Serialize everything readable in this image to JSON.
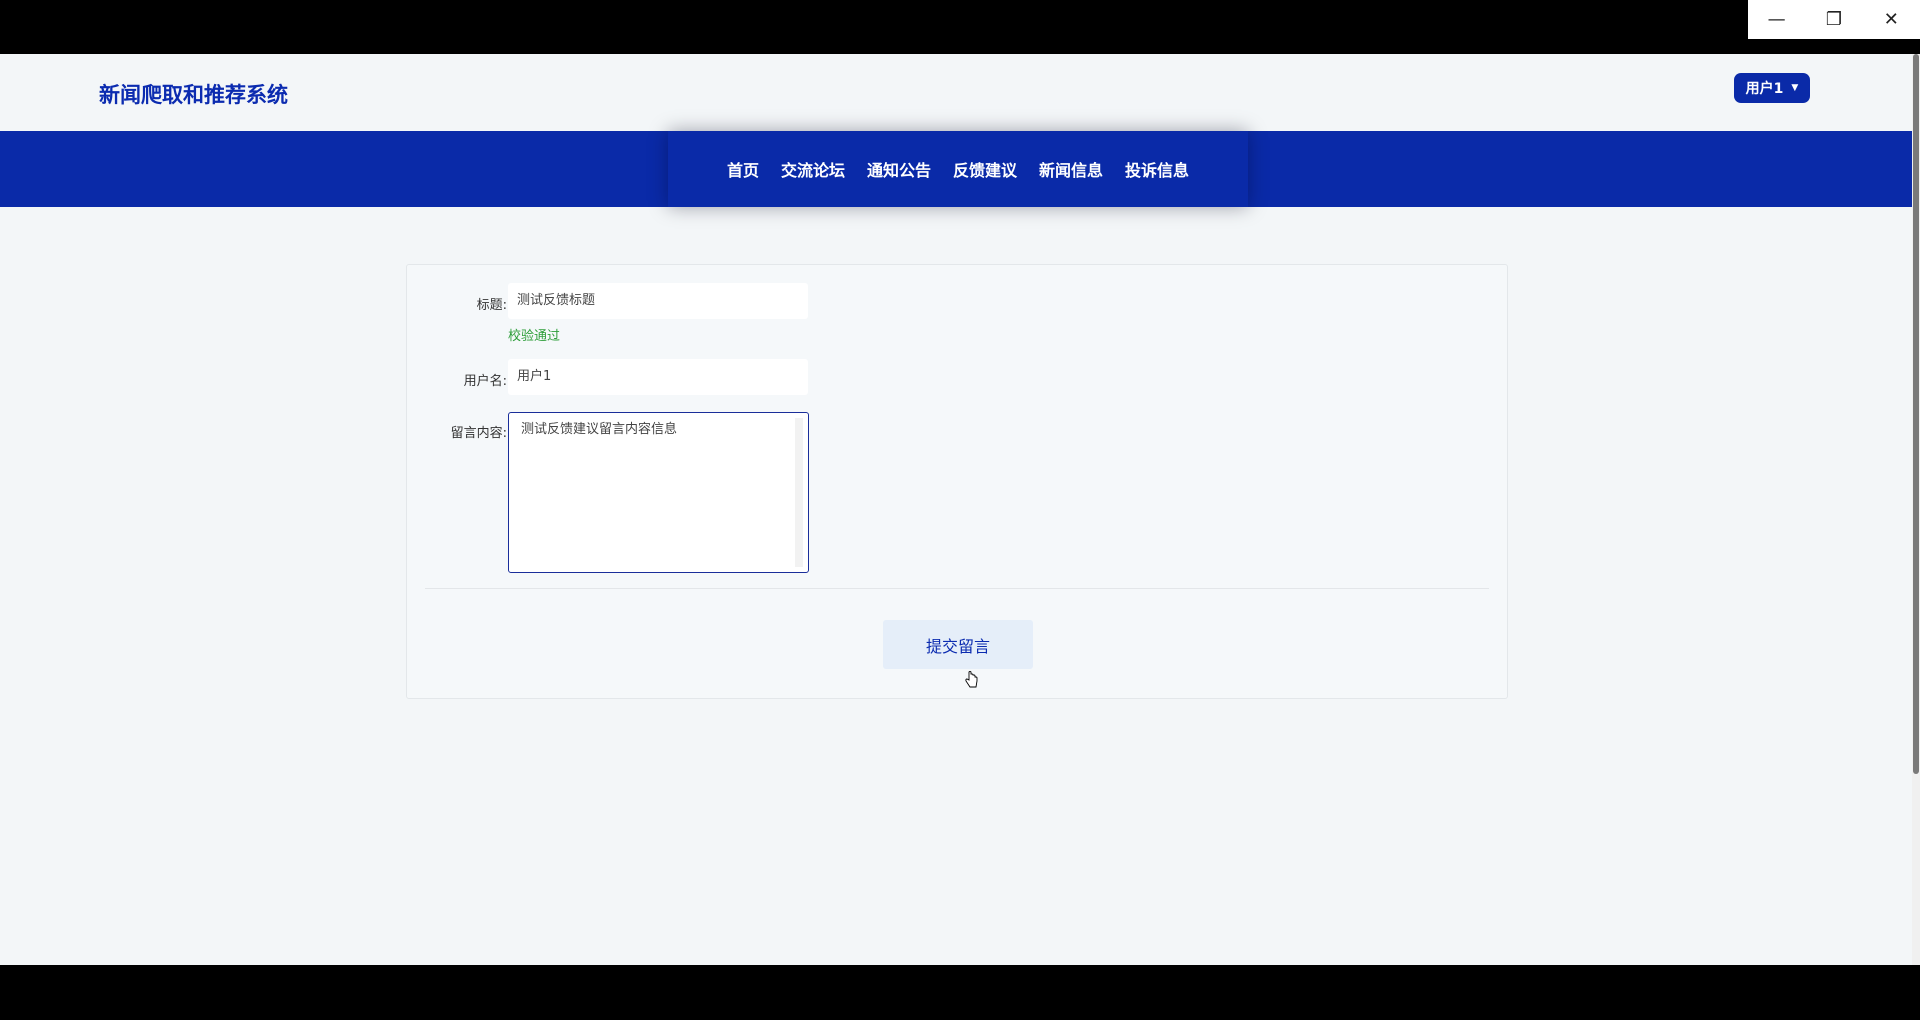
{
  "window": {
    "controls": {
      "minimize": "—",
      "restore": "❐",
      "close": "✕"
    }
  },
  "header": {
    "title": "新闻爬取和推荐系统",
    "user_label": "用户1",
    "user_caret": "▼"
  },
  "nav": {
    "items": [
      "首页",
      "交流论坛",
      "通知公告",
      "反馈建议",
      "新闻信息",
      "投诉信息"
    ]
  },
  "form": {
    "title_label": "标题:",
    "title_value": "测试反馈标题",
    "title_validation": "校验通过",
    "username_label": "用户名:",
    "username_value": "用户1",
    "content_label": "留言内容:",
    "content_value": "测试反馈建议留言内容信息",
    "submit_label": "提交留言"
  },
  "colors": {
    "brand": "#0a2aa8",
    "title_text": "#0b2bb0",
    "validation": "#2e9e3a",
    "page_bg": "#f3f6f8"
  }
}
